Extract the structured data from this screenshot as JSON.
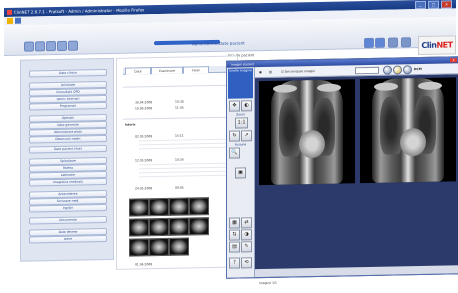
{
  "window": {
    "title": "ClinNET 2.6.7.1 - Pratsoft - Admin / Administrator - Mozilla Firefox"
  },
  "header": {
    "title": "Administrare/Date pacient",
    "subtitle": "Fișa de pacient",
    "logo_main": "Clin",
    "logo_accent": "NET"
  },
  "sidebar": {
    "items": [
      {
        "label": "Date clinice"
      },
      {
        "label": "Activitate"
      },
      {
        "label": "Consultatii OPD"
      },
      {
        "label": "Istoric internari"
      },
      {
        "label": "Programari"
      },
      {
        "label": "Operatii"
      },
      {
        "label": "Date generale"
      },
      {
        "label": "Administrare plata"
      },
      {
        "label": "Observatii medic"
      },
      {
        "label": "Date pacient (fise)"
      },
      {
        "label": "Spitalizare"
      },
      {
        "label": "Reteta"
      },
      {
        "label": "Laborator"
      },
      {
        "label": "Imagistica medicala"
      },
      {
        "label": "Antecedente"
      },
      {
        "label": "Scrisoare med."
      },
      {
        "label": "Ingrijiri"
      },
      {
        "label": "Documente"
      },
      {
        "label": "Date decese"
      },
      {
        "label": "Iesire"
      }
    ]
  },
  "main": {
    "tabs": [
      "Date",
      "Examinare",
      "Fisier"
    ],
    "rows": [
      {
        "date": "30.04.2008",
        "time": "10:30"
      },
      {
        "date": "19.06.2008",
        "time": "11:45"
      }
    ],
    "section_label": "Istoric",
    "entries": [
      {
        "date": "02.05.2008",
        "time": "15:11"
      },
      {
        "date": "12.05.2008",
        "time": "10:24"
      },
      {
        "date": "24.05.2008",
        "time": "09:05"
      }
    ],
    "footer_date": "01.06.2008"
  },
  "viewer": {
    "title": "Imagini pacient",
    "close": "X",
    "tool_header": "Unelte imagine",
    "zoom_label": "Zoom",
    "zoom_value": "1:1",
    "fusion_label": "Fuziune",
    "sync_label": "Sincronizare imagini",
    "dcm_label": "DCM",
    "status": "Imagine 1/1"
  },
  "colors": {
    "accent": "#2f63c7",
    "viewer_bg": "#2b3a6a",
    "close": "#e03b2c"
  }
}
